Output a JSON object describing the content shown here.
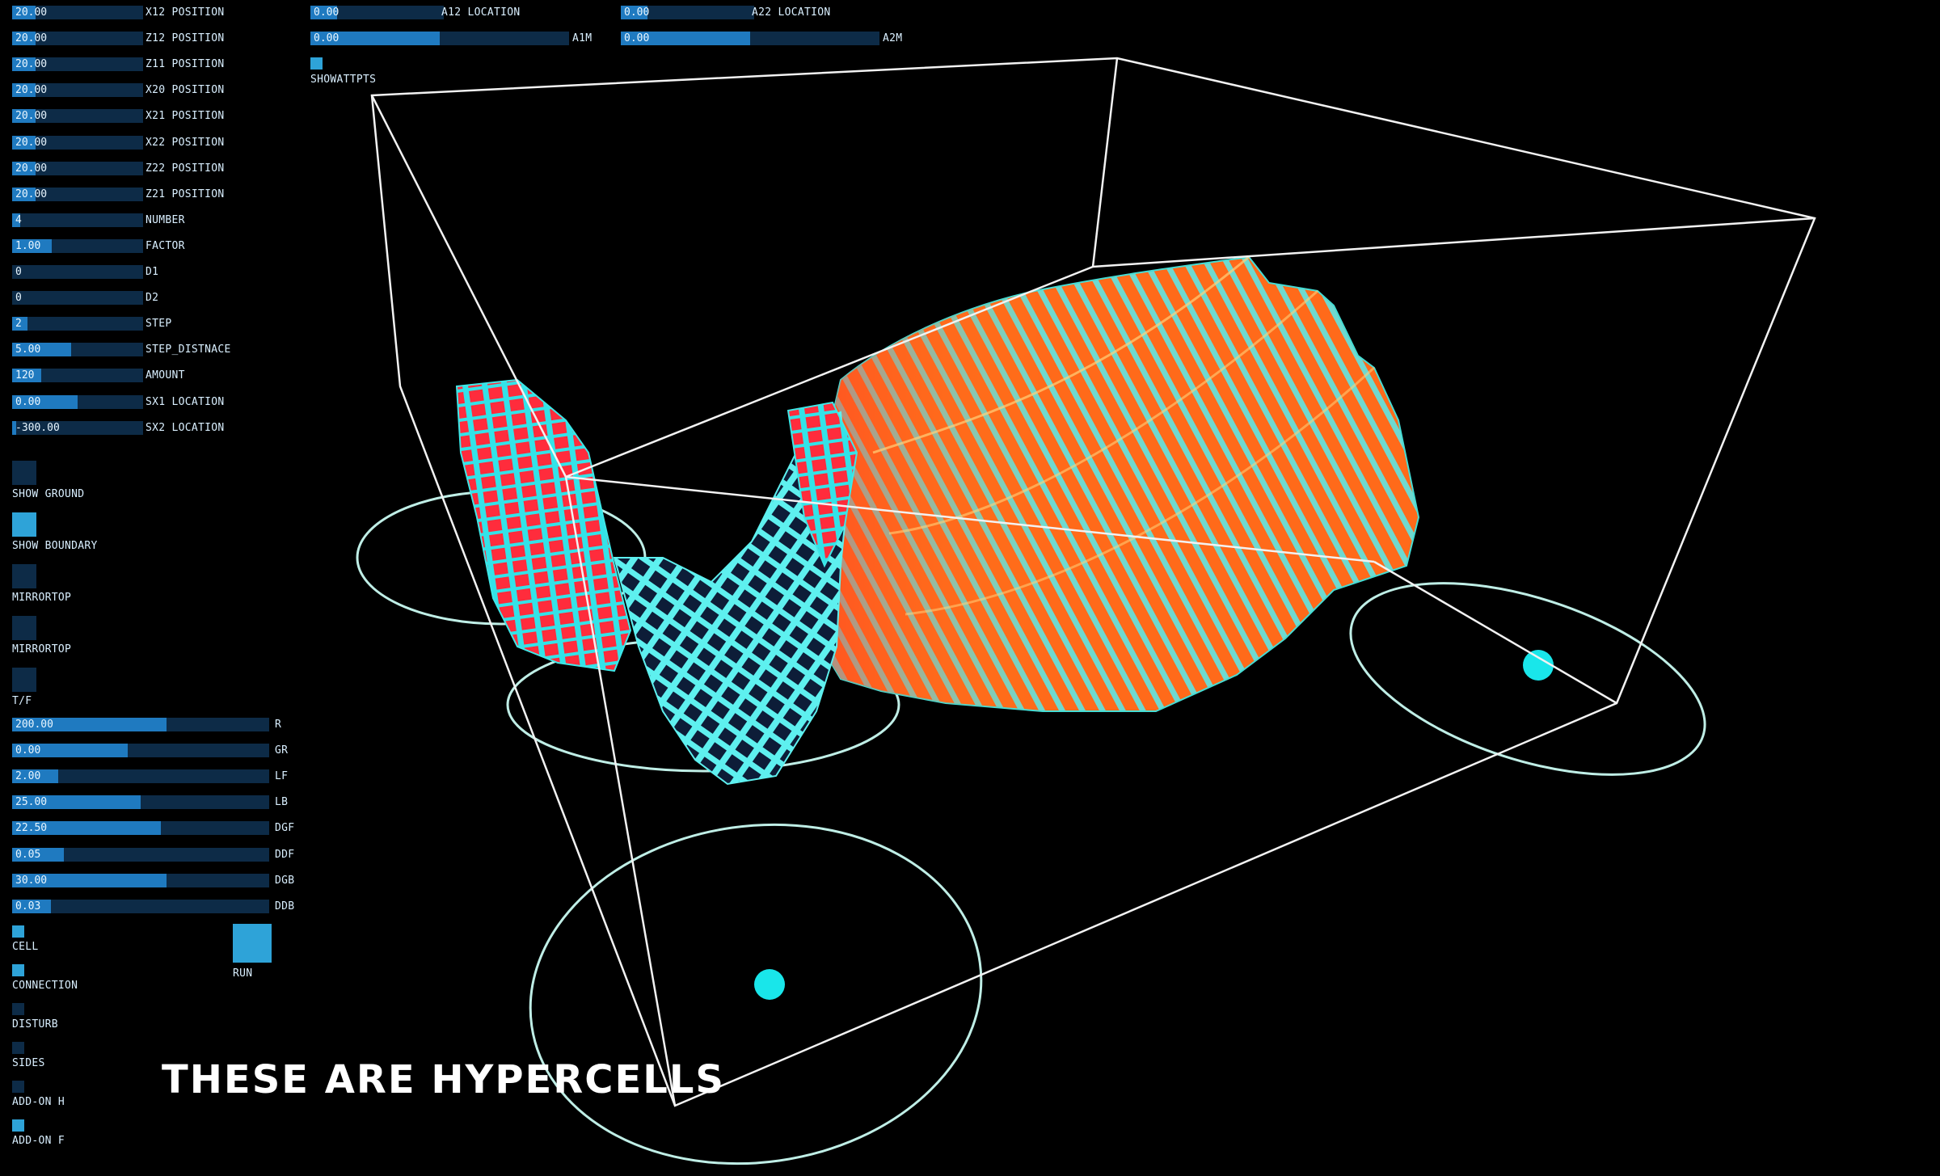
{
  "top_controls": [
    {
      "value": "0.00",
      "label": "A12 LOCATION",
      "fill": 0.2
    },
    {
      "value": "0.00",
      "label": "A1M",
      "fill": 0.5
    },
    {
      "value": "0.00",
      "label": "A22 LOCATION",
      "fill": 0.2
    },
    {
      "value": "0.00",
      "label": "A2M",
      "fill": 0.5
    }
  ],
  "top_toggle_label": "SHOWATTPTS",
  "left_sliders": [
    {
      "value": "20.00",
      "label": "X12 POSITION",
      "fill": 0.18
    },
    {
      "value": "20.00",
      "label": "Z12 POSITION",
      "fill": 0.18
    },
    {
      "value": "20.00",
      "label": "Z11 POSITION",
      "fill": 0.18
    },
    {
      "value": "20.00",
      "label": "X20 POSITION",
      "fill": 0.18
    },
    {
      "value": "20.00",
      "label": "X21 POSITION",
      "fill": 0.18
    },
    {
      "value": "20.00",
      "label": "X22 POSITION",
      "fill": 0.18
    },
    {
      "value": "20.00",
      "label": "Z22 POSITION",
      "fill": 0.18
    },
    {
      "value": "20.00",
      "label": "Z21 POSITION",
      "fill": 0.18
    },
    {
      "value": "4",
      "label": "NUMBER",
      "fill": 0.06
    },
    {
      "value": "1.00",
      "label": "FACTOR",
      "fill": 0.3
    },
    {
      "value": "0",
      "label": "D1",
      "fill": 0.0
    },
    {
      "value": "0",
      "label": "D2",
      "fill": 0.0
    },
    {
      "value": "2",
      "label": "STEP",
      "fill": 0.12
    },
    {
      "value": "5.00",
      "label": "STEP_DISTNACE",
      "fill": 0.45
    },
    {
      "value": "120",
      "label": "AMOUNT",
      "fill": 0.22
    },
    {
      "value": "0.00",
      "label": "SX1 LOCATION",
      "fill": 0.5
    },
    {
      "value": "-300.00",
      "label": "SX2 LOCATION",
      "fill": 0.03
    }
  ],
  "left_toggles": [
    {
      "label": "SHOW GROUND",
      "on": false
    },
    {
      "label": "SHOW BOUNDARY",
      "on": true
    },
    {
      "label": "MIRRORTOP",
      "on": false
    },
    {
      "label": "MIRRORTOP",
      "on": false
    },
    {
      "label": "T/F",
      "on": false
    }
  ],
  "lower_sliders": [
    {
      "value": "200.00",
      "label": "R",
      "fill": 0.6
    },
    {
      "value": "0.00",
      "label": "GR",
      "fill": 0.45
    },
    {
      "value": "2.00",
      "label": "LF",
      "fill": 0.18
    },
    {
      "value": "25.00",
      "label": "LB",
      "fill": 0.5
    },
    {
      "value": "22.50",
      "label": "DGF",
      "fill": 0.58
    },
    {
      "value": "0.05",
      "label": "DDF",
      "fill": 0.2
    },
    {
      "value": "30.00",
      "label": "DGB",
      "fill": 0.6
    },
    {
      "value": "0.03",
      "label": "DDB",
      "fill": 0.15
    }
  ],
  "bottom_toggles": [
    {
      "label": "CELL",
      "on": true
    },
    {
      "label": "CONNECTION",
      "on": true
    },
    {
      "label": "DISTURB",
      "on": false
    },
    {
      "label": "SIDES",
      "on": false
    },
    {
      "label": "ADD-ON H",
      "on": false
    },
    {
      "label": "ADD-ON F",
      "on": true
    }
  ],
  "run_label": "RUN",
  "caption": "THESE ARE HYPERCELLS",
  "colors": {
    "accent": "#2ea3d8",
    "track": "#0d2b47",
    "cyan": "#19e6ea",
    "orange": "#ff6a1a",
    "red": "#ff2a3a",
    "background": "#000000"
  }
}
